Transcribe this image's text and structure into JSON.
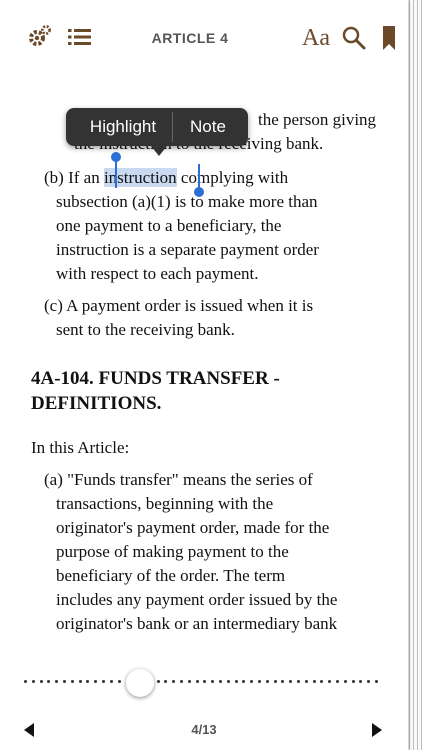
{
  "header": {
    "title": "ARTICLE 4",
    "icons": [
      "gear-icon",
      "list-icon",
      "font-size-icon",
      "search-icon",
      "bookmark-icon"
    ],
    "font_label": "Aa"
  },
  "popup": {
    "highlight": "Highlight",
    "note": "Note"
  },
  "content": {
    "hidden_line1": "the person giving",
    "hidden_line2": "the instruction to the receiving bank.",
    "b_pre": "(b)  If an ",
    "b_selected": "instruction",
    "b_post": " complying with",
    "b_lines": [
      "subsection (a)(1) is to make more than",
      "one payment to a beneficiary, the",
      "instruction is a separate payment order",
      "with respect to each payment."
    ],
    "c_line1": "(c)  A payment order is issued when it is",
    "c_line2": "sent to the receiving bank.",
    "heading_line1": "4A-104. FUNDS TRANSFER -",
    "heading_line2": "DEFINITIONS.",
    "intro": "In this Article:",
    "a_line1": "(a)  \"Funds transfer\" means the series of",
    "a_lines": [
      "transactions, beginning with the",
      "originator's payment order, made for the",
      "purpose of making payment to the",
      "beneficiary of the order. The term",
      "includes any payment order issued by the",
      "originator's bank or an intermediary bank"
    ]
  },
  "footer": {
    "page_label": "4/13",
    "progress": 0.31
  },
  "colors": {
    "accent": "#6b4a2a",
    "selection": "#c9d9ef",
    "handle": "#2a6fd6"
  }
}
